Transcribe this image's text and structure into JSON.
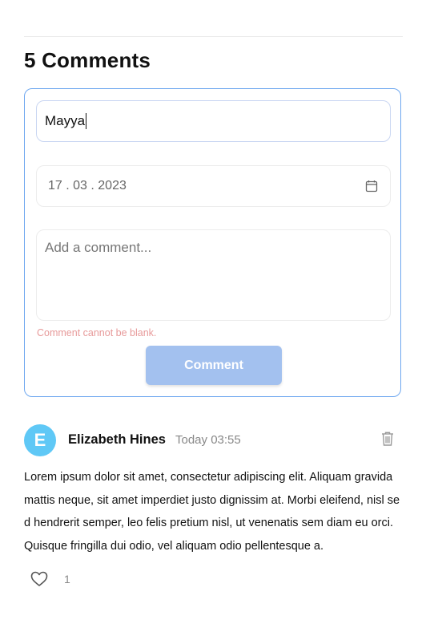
{
  "comments_section": {
    "title": "5 Comments"
  },
  "form": {
    "name_value": "Mayya",
    "date_value": "17 . 03 . 2023",
    "comment_placeholder": "Add a comment...",
    "error_message": "Comment cannot be blank.",
    "submit_label": "Comment",
    "accent_color": "#6fa8f0",
    "error_color": "#e79a9a",
    "button_color": "#a3c1ef"
  },
  "comment": {
    "avatar_letter": "E",
    "avatar_color": "#5fc8f6",
    "author": "Elizabeth Hines",
    "timestamp": "Today 03:55",
    "body": "Lorem ipsum dolor sit amet, consectetur adipiscing elit. Aliquam gravida mattis neque, sit amet imperdiet justo dignissim at. Morbi eleifend, nisl sed hendrerit semper, leo felis pretium nisl, ut venenatis sem diam eu orci. Quisque fringilla dui odio, vel aliquam odio pellentesque a.",
    "like_count": "1",
    "icons": {
      "delete": "trash-icon",
      "like": "heart-icon",
      "date": "calendar-icon"
    }
  }
}
